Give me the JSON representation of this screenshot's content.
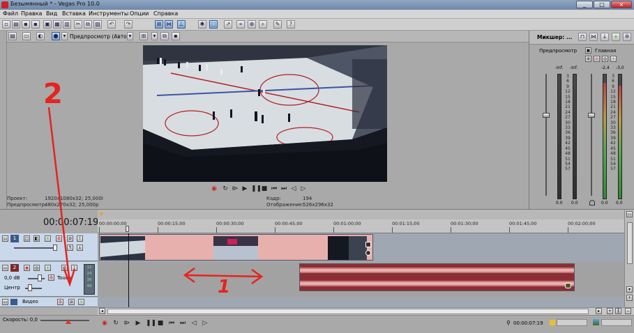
{
  "window": {
    "title": "Безымянный * - Vegas Pro 10.0",
    "controls": [
      "_",
      "□",
      "×"
    ]
  },
  "menu": [
    "Файл",
    "Правка",
    "Вид",
    "Вставка",
    "Инструменты",
    "Опции",
    "Справка"
  ],
  "preview": {
    "mode_label": "Предпросмотр (Авто)",
    "project_label": "Проект:",
    "project_value": "1920x1080x32; 25,000i",
    "preview_label": "Предпросмотр:",
    "preview_value": "480x270x32; 25,000p",
    "frame_label": "Кадр:",
    "frame_value": "194",
    "display_label": "Отображение:",
    "display_value": "526x296x32"
  },
  "mixer": {
    "title": "Микшер: ...",
    "preview_label": "Предпросмотр",
    "main_label": "Главная",
    "peak_left": "-Inf.",
    "peak_right": "-Inf.",
    "main_peak_left": "-2,4",
    "main_peak_right": "-3,0",
    "scale": [
      "3",
      "6",
      "9",
      "12",
      "15",
      "18",
      "21",
      "24",
      "27",
      "30",
      "33",
      "36",
      "39",
      "42",
      "45",
      "48",
      "51",
      "54",
      "57"
    ],
    "value_left": "0.0",
    "value_right": "0.0",
    "main_value_left": "0.0",
    "main_value_right": "0.0"
  },
  "timeline": {
    "timecode": "00:00:07:19",
    "ruler_labels": [
      "00:00:00;00",
      "00:00:15;00",
      "00:00:30;00",
      "00:00:45;00",
      "00:01:00;00",
      "00:01:15;00",
      "00:01:30;00",
      "00:01:45;00",
      "00:02:00;00"
    ],
    "track1_number": "1",
    "track2_number": "2",
    "track2_volume": "0,0 dB",
    "track2_touch": "Touch",
    "track2_pan": "Центр",
    "track3_label": "Видео",
    "speed_label": "Скорость: 0,0",
    "status_timecode": "00:00:07:19",
    "audio_meter": [
      "12",
      "24",
      "36",
      "48"
    ]
  },
  "annotations": {
    "number_2": "2",
    "number_1": "1"
  },
  "colors": {
    "video_clip": "#e8b0ad",
    "audio_clip": "#8a2f34",
    "annotation": "#e5231f"
  }
}
